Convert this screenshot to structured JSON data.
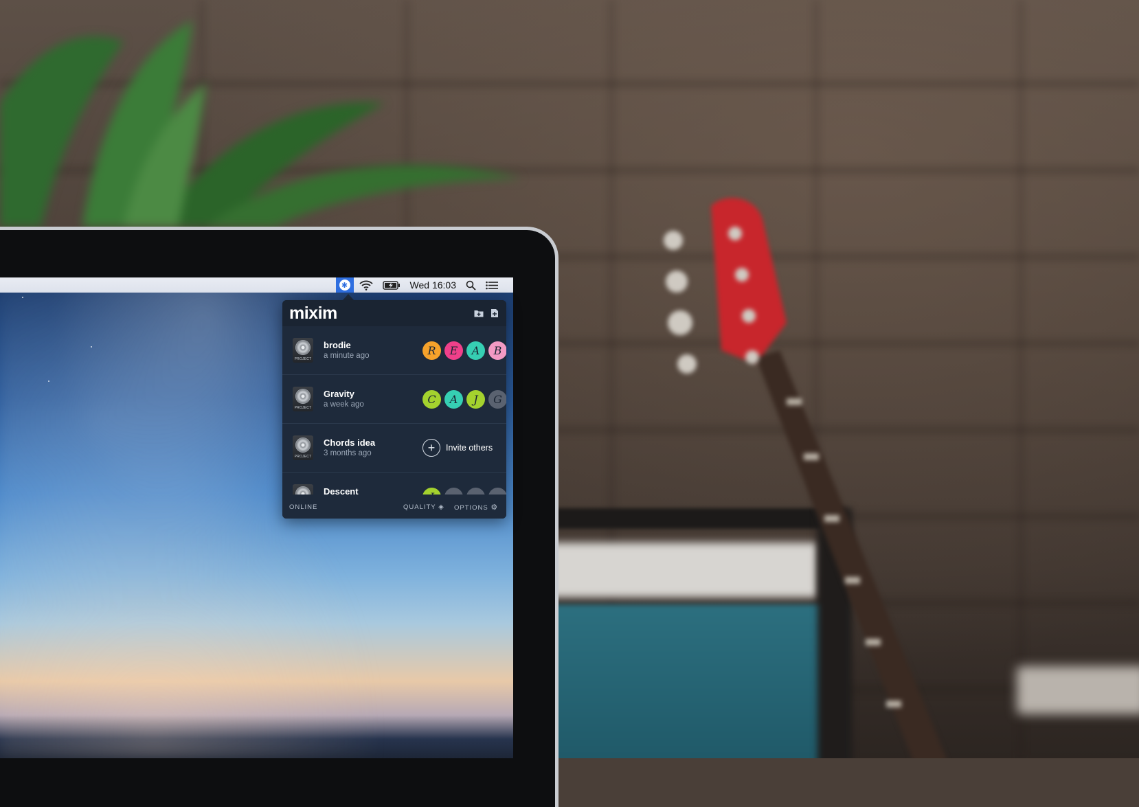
{
  "menubar": {
    "clock": "Wed 16:03",
    "icons": [
      "mixim-icon",
      "wifi-icon",
      "battery-charging-icon",
      "spotlight-search-icon",
      "notification-center-icon"
    ]
  },
  "popover": {
    "brand": "mixim",
    "header_icons": [
      "add-folder-icon",
      "new-project-icon"
    ],
    "projects": [
      {
        "name": "brodie",
        "time": "a minute ago",
        "collaborators": [
          "R",
          "E",
          "A",
          "B"
        ]
      },
      {
        "name": "Gravity",
        "time": "a week ago",
        "collaborators": [
          "C",
          "A",
          "J",
          "G"
        ]
      },
      {
        "name": "Chords idea",
        "time": "3 months ago",
        "invite_label": "Invite others"
      },
      {
        "name": "Descent",
        "time": "",
        "collaborators": [
          "J",
          "",
          "",
          ""
        ]
      }
    ],
    "project_thumb_label": "PROJECT",
    "footer": {
      "status": "ONLINE",
      "quality": "QUALITY",
      "options": "OPTIONS"
    }
  },
  "colors": {
    "avatar_orange": "#f6a22b",
    "avatar_pink": "#f0408a",
    "avatar_teal": "#36cfb3",
    "avatar_lime": "#a4d22e",
    "avatar_lightpink": "#f39ac4",
    "avatar_gray": "#5a6270",
    "popover_bg": "#1e2a3b",
    "menubar_accent": "#2f6fe0"
  }
}
